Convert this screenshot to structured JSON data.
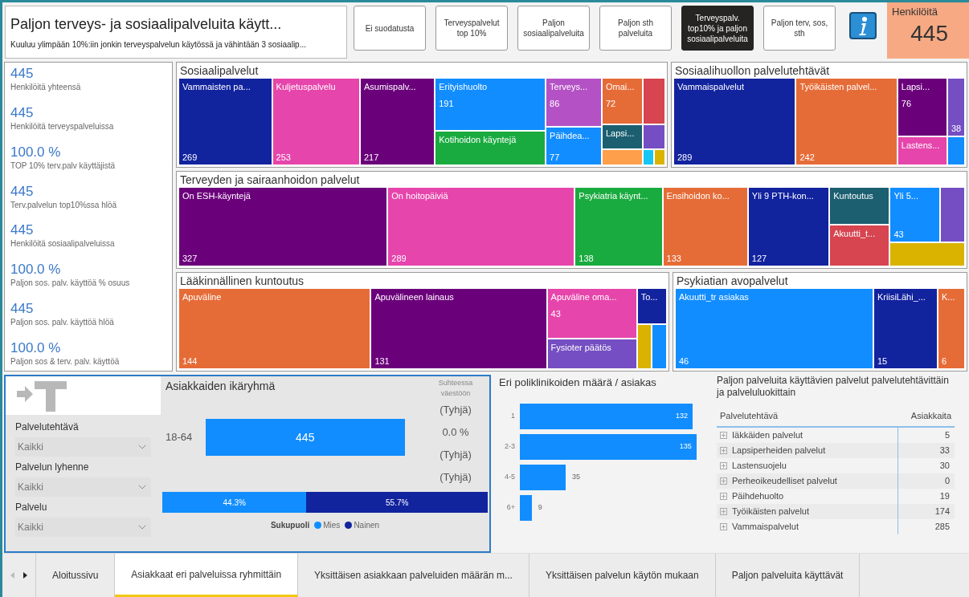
{
  "header": {
    "title": "Paljon terveys- ja sosiaalipalveluita käytt...",
    "subtitle": "Kuuluu ylimpään 10%:iin jonkin terveyspalvelun käytössä ja vähintään 3 sosiaalip...",
    "filters": [
      {
        "label": "Ei suodatusta",
        "selected": false
      },
      {
        "label": "Terveyspalvelut top 10%",
        "selected": false
      },
      {
        "label": "Paljon sosiaalipalveluita",
        "selected": false
      },
      {
        "label": "Paljon sth palveluita",
        "selected": false
      },
      {
        "label": "Terveyspalv. top10% ja paljon sosiaalipalveluita",
        "selected": true
      },
      {
        "label": "Paljon terv, sos, sth",
        "selected": false
      }
    ],
    "kpi": {
      "label": "Henkilöitä",
      "value": "445"
    }
  },
  "kpis": [
    {
      "value": "445",
      "label": "Henkilöitä yhteensä"
    },
    {
      "value": "445",
      "label": "Henkilöitä terveyspalveluissa"
    },
    {
      "value": "100.0 %",
      "label": "TOP 10% terv.palv käyttäjistä"
    },
    {
      "value": "445",
      "label": "Terv.palvelun top10%ssa hlöä"
    },
    {
      "value": "445",
      "label": "Henkilöitä sosiaalipalveluissa"
    },
    {
      "value": "100.0 %",
      "label": "Paljon sos. palv. käyttöä % osuus"
    },
    {
      "value": "445",
      "label": "Paljon sos. palv. käyttöä hlöä"
    },
    {
      "value": "100.0 %",
      "label": "Paljon sos & terv. palv. käyttöä"
    }
  ],
  "treemaps": [
    {
      "title": "Sosiaalipalvelut",
      "tiles": [
        {
          "label": "Vammaisten pa...",
          "value": "269",
          "color": "#12239e"
        },
        {
          "label": "Kuljetuspalvelu",
          "value": "253",
          "color": "#e645ab"
        },
        {
          "label": "Asumispalv...",
          "value": "217",
          "color": "#6b007b"
        },
        {
          "tiles": [
            {
              "label": "Erityishuolto",
              "value": "191",
              "color": "#118dff"
            },
            {
              "label": "Kotihoidon käyntejä",
              "color": "#1aab40"
            }
          ]
        },
        {
          "tiles": [
            {
              "label": "Terveys...",
              "value": "86",
              "color": "#b452c5"
            },
            {
              "label": "Päihdea...",
              "value": "77",
              "color": "#118dff"
            }
          ]
        },
        {
          "tiles": [
            {
              "label": "Omai...",
              "value": "72",
              "color": "#e66c37"
            },
            {
              "label": "Lapsi...",
              "color": "#1b5f70"
            },
            {
              "color": "#fe9f4c"
            }
          ]
        },
        {
          "tiles": [
            {
              "color": "#d64550"
            },
            {
              "color": "#744ec2"
            },
            {
              "tiles": [
                {
                  "color": "#15c6f4"
                },
                {
                  "color": "#d9b300"
                }
              ]
            }
          ]
        }
      ]
    },
    {
      "title": "Sosiaalihuollon palvelutehtävät",
      "tiles": [
        {
          "label": "Vammaispalvelut",
          "value": "289",
          "color": "#12239e"
        },
        {
          "label": "Työikäisten palvel...",
          "value": "242",
          "color": "#e66c37"
        },
        {
          "tiles": [
            {
              "label": "Lapsi...",
              "value": "76",
              "color": "#6b007b"
            },
            {
              "label": "Lastens...",
              "color": "#e645ab"
            }
          ]
        },
        {
          "tiles": [
            {
              "value": "38",
              "color": "#744ec2"
            },
            {
              "color": "#118dff"
            }
          ]
        }
      ]
    },
    {
      "title": "Terveyden ja sairaanhoidon palvelut",
      "tiles": [
        {
          "label": "On ESH-käyntejä",
          "value": "327",
          "color": "#6b007b"
        },
        {
          "label": "On hoitopäiviä",
          "value": "289",
          "color": "#e645ab"
        },
        {
          "label": "Psykiatria käynt...",
          "value": "138",
          "color": "#1aab40"
        },
        {
          "label": "Ensihoidon ko...",
          "value": "133",
          "color": "#e66c37"
        },
        {
          "label": "Yli 9 PTH-kon...",
          "value": "127",
          "color": "#12239e"
        },
        {
          "tiles": [
            {
              "label": "Kuntoutus",
              "color": "#1b5f70"
            },
            {
              "label": "Akuutti_t...",
              "color": "#d64550"
            }
          ]
        },
        {
          "tiles": [
            {
              "tiles": [
                {
                  "label": "Yli 5...",
                  "value": "43",
                  "color": "#118dff"
                },
                {
                  "color": "#744ec2"
                }
              ]
            },
            {
              "color": "#d9b300"
            }
          ]
        }
      ]
    },
    {
      "title": "Lääkinnällinen kuntoutus",
      "tiles": [
        {
          "label": "Apuväline",
          "value": "144",
          "color": "#e66c37"
        },
        {
          "label": "Apuvälineen lainaus",
          "value": "131",
          "color": "#6b007b"
        },
        {
          "tiles": [
            {
              "label": "Apuväline oma...",
              "value": "43",
              "color": "#e645ab"
            },
            {
              "label": "Fysioter päätös",
              "color": "#744ec2"
            }
          ]
        },
        {
          "tiles": [
            {
              "label": "To...",
              "color": "#12239e"
            },
            {
              "tiles": [
                {
                  "color": "#d9b300"
                },
                {
                  "color": "#118dff"
                }
              ]
            }
          ]
        }
      ]
    },
    {
      "title": "Psykiatian avopalvelut",
      "tiles": [
        {
          "label": "Akuutti_tr asiakas",
          "value": "46",
          "color": "#118dff"
        },
        {
          "label": "KriisiLähi_...",
          "value": "15",
          "color": "#12239e"
        },
        {
          "label": "K...",
          "value": "6",
          "color": "#e66c37"
        }
      ]
    }
  ],
  "slicers": [
    {
      "label": "Palvelutehtävä",
      "value": "Kaikki"
    },
    {
      "label": "Palvelun lyhenne",
      "value": "Kaikki"
    },
    {
      "label": "Palvelu",
      "value": "Kaikki"
    }
  ],
  "age_chart": {
    "chart_data": {
      "type": "bar",
      "orientation": "horizontal",
      "title": "Asiakkaiden ikäryhmä",
      "categories": [
        "18-64"
      ],
      "values": [
        445
      ],
      "data_labels": true
    },
    "side_title": "Suhteessa väestöön",
    "side_values": [
      "(Tyhjä)",
      "0.0 %",
      "(Tyhjä)",
      "(Tyhjä)"
    ]
  },
  "gender": {
    "title": "Sukupuoli",
    "segments": [
      {
        "name": "Mies",
        "reading": "44.3%",
        "level": 0.443,
        "color": "#118dff"
      },
      {
        "name": "Nainen",
        "reading": "55.7%",
        "level": 0.557,
        "color": "#12239e"
      }
    ]
  },
  "clinic_chart": {
    "chart_data": {
      "type": "bar",
      "orientation": "horizontal",
      "title": "Eri poliklinikoiden määrä / asiakas",
      "categories": [
        "1",
        "2-3",
        "4-5",
        "6+"
      ],
      "values": [
        132,
        135,
        35,
        9
      ],
      "data_labels": true
    }
  },
  "table": {
    "title": "Paljon palveluita käyttävien palvelut palvelutehtävittäin ja palveluluokittain",
    "columns": [
      "Palvelutehtävä",
      "Asiakkaita"
    ],
    "rows": [
      {
        "name": "Iäkkäiden palvelut",
        "value": "5"
      },
      {
        "name": "Lapsiperheiden palvelut",
        "value": "33"
      },
      {
        "name": "Lastensuojelu",
        "value": "30"
      },
      {
        "name": "Perheoikeudelliset palvelut",
        "value": "0"
      },
      {
        "name": "Päihdehuolto",
        "value": "19"
      },
      {
        "name": "Työikäisten palvelut",
        "value": "174"
      },
      {
        "name": "Vammaispalvelut",
        "value": "285"
      }
    ]
  },
  "tabs": [
    {
      "label": "Aloitussivu",
      "selected": false
    },
    {
      "label": "Asiakkaat eri palveluissa ryhmittäin",
      "selected": true
    },
    {
      "label": "Yksittäisen asiakkaan palveluiden määrän m...",
      "selected": false
    },
    {
      "label": "Yksittäisen palvelun käytön mukaan",
      "selected": false
    },
    {
      "label": "Paljon palveluita käyttävät",
      "selected": false
    }
  ]
}
